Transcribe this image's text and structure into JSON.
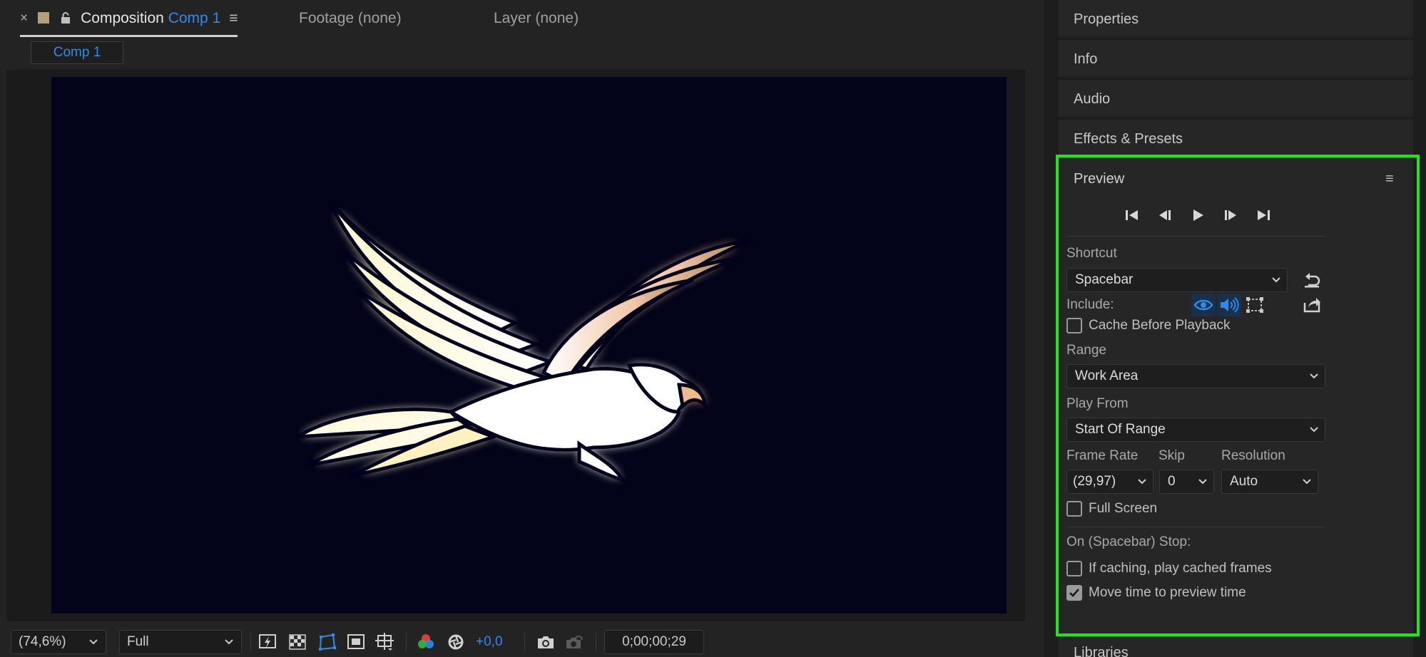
{
  "composition_panel": {
    "tabs": {
      "close_glyph": "×",
      "composition_prefix": "Composition",
      "composition_name": "Comp 1",
      "menu_glyph": "≡",
      "footage": "Footage (none)",
      "layer": "Layer (none)"
    },
    "comp_chip": "Comp 1",
    "swatch_color": "#b3a17c",
    "canvas_color": "#03041a",
    "toolbar": {
      "zoom": "(74,6%)",
      "resolution": "Full",
      "exposure": "+0,0",
      "timecode": "0;00;00;29",
      "icons": [
        "fast-preview-icon",
        "transparency-grid-icon",
        "mask-visibility-icon",
        "region-of-interest-icon",
        "safe-zones-icon",
        "channel-icon",
        "reset-exposure-icon",
        "snapshot-icon",
        "show-snapshot-icon"
      ]
    }
  },
  "right_panel": {
    "collapsed_items": [
      "Properties",
      "Info",
      "Audio",
      "Effects & Presets"
    ],
    "libraries": "Libraries",
    "preview": {
      "title": "Preview",
      "menu_glyph": "≡",
      "transport_icons": [
        "first-frame-icon",
        "previous-frame-icon",
        "play-icon",
        "next-frame-icon",
        "last-frame-icon"
      ],
      "shortcut_label": "Shortcut",
      "shortcut_value": "Spacebar",
      "include_label": "Include:",
      "include_icons": [
        "video-eye-icon",
        "audio-speaker-icon",
        "overlays-icon"
      ],
      "cache_before_playback": {
        "label": "Cache Before Playback",
        "checked": false
      },
      "range_label": "Range",
      "range_value": "Work Area",
      "play_from_label": "Play From",
      "play_from_value": "Start Of Range",
      "frame_rate_label": "Frame Rate",
      "frame_rate_value": "(29,97)",
      "skip_label": "Skip",
      "skip_value": "0",
      "resolution_label": "Resolution",
      "resolution_value": "Auto",
      "full_screen": {
        "label": "Full Screen",
        "checked": false
      },
      "on_stop_label": "On (Spacebar) Stop:",
      "if_caching": {
        "label": "If caching, play cached frames",
        "checked": false
      },
      "move_time": {
        "label": "Move time to preview time",
        "checked": true
      },
      "highlight_color": "#1ee81a",
      "accent_color": "#2d8ceb"
    }
  }
}
